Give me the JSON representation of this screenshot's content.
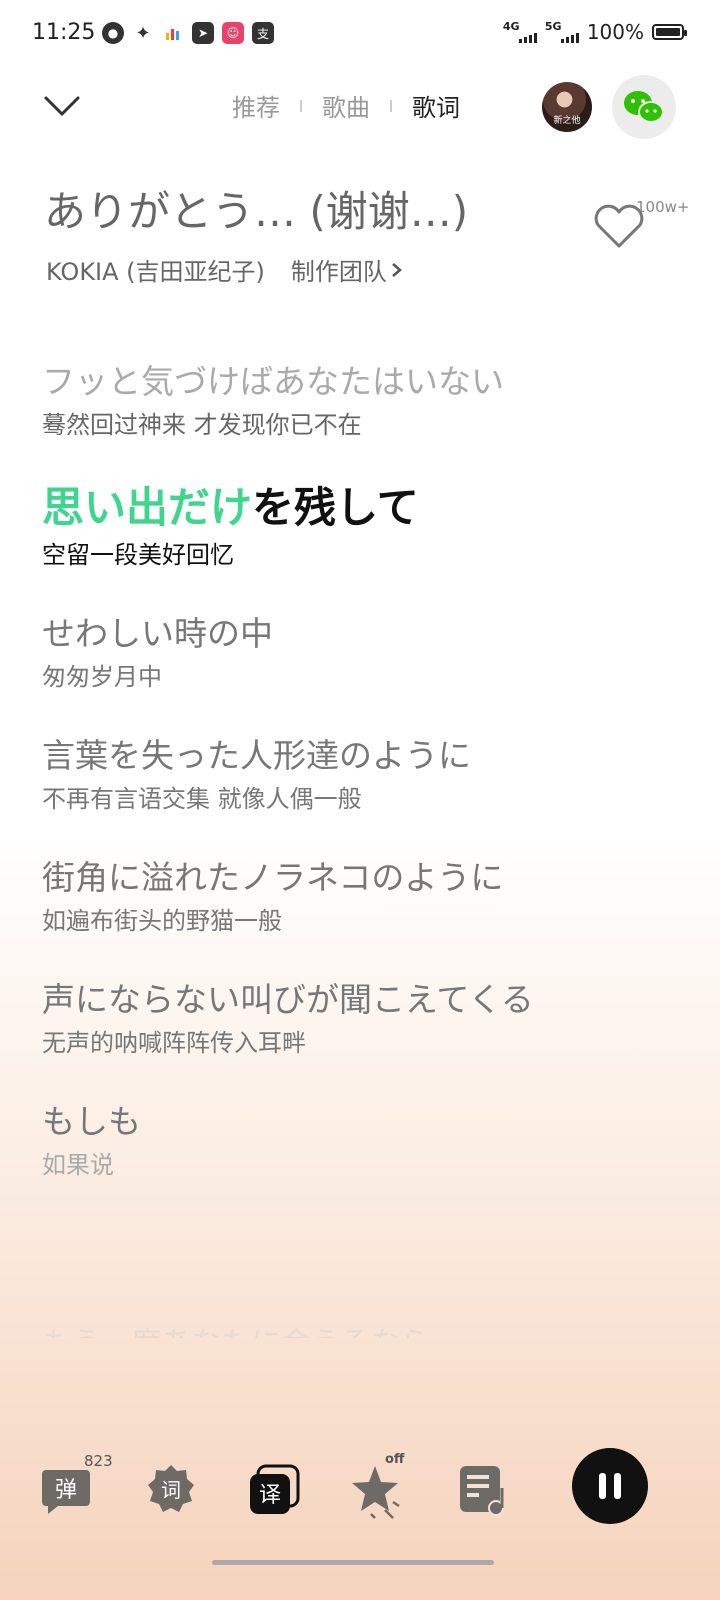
{
  "status": {
    "time": "11:25",
    "net1": "4G",
    "net2": "5G",
    "battery": "100%"
  },
  "nav": {
    "tabs": [
      "推荐",
      "歌曲",
      "歌词"
    ],
    "active_tab": "歌词"
  },
  "song": {
    "title": "ありがとう… (谢谢…)",
    "like_count": "100w+",
    "artist": "KOKIA (吉田亚纪子)",
    "credits_label": "制作团队"
  },
  "avatar": {
    "label": "新之他"
  },
  "lyrics": {
    "past": {
      "jp": "フッと気づけばあなたはいない",
      "cn": "蓦然回过神来 才发现你已不在"
    },
    "current": {
      "jp_sung": "思い出だけ",
      "jp_rest": "を残して",
      "cn": "空留一段美好回忆"
    },
    "upcoming": [
      {
        "jp": "せわしい時の中",
        "cn": "匆匆岁月中"
      },
      {
        "jp": "言葉を失った人形達のように",
        "cn": "不再有言语交集 就像人偶一般"
      },
      {
        "jp": "街角に溢れたノラネコのように",
        "cn": "如遍布街头的野猫一般"
      },
      {
        "jp": "声にならない叫びが聞こえてくる",
        "cn": "无声的呐喊阵阵传入耳畔"
      },
      {
        "jp": "もしも",
        "cn": "如果说"
      }
    ],
    "faded_next": "もう一度あなたに会えるなら"
  },
  "toolbar": {
    "danmaku_label": "弹",
    "danmaku_count": "823",
    "lyrics_label": "词",
    "translate_label": "译",
    "effect_state": "off"
  },
  "colors": {
    "accent": "#3ed58c",
    "wechat": "#2dc100"
  }
}
